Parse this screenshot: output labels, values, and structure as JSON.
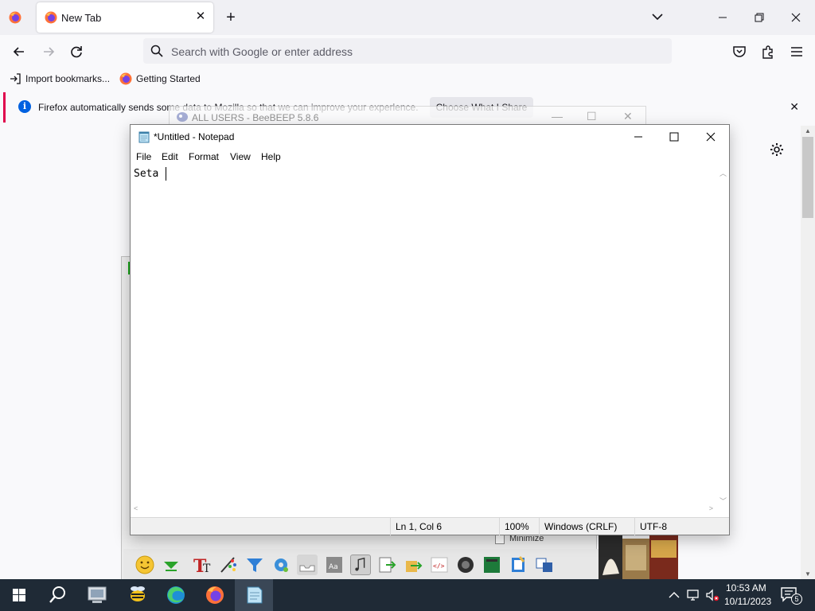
{
  "browser": {
    "tab": {
      "title": "New Tab"
    },
    "address_bar": {
      "placeholder": "Search with Google or enter address"
    },
    "bookmarks": [
      {
        "label": "Import bookmarks..."
      },
      {
        "label": "Getting Started"
      }
    ],
    "notification": {
      "text": "Firefox automatically sends some data to Mozilla so that we can improve your experience.",
      "button": "Choose What I Share"
    }
  },
  "background_windows": {
    "beebeep_title": "ALL USERS - BeeBEEP 5.8.6",
    "minimize_label": "Minimize"
  },
  "notepad": {
    "title": "*Untitled - Notepad",
    "menu": [
      "File",
      "Edit",
      "Format",
      "View",
      "Help"
    ],
    "content": "Seta ",
    "status": {
      "position": "Ln 1, Col 6",
      "zoom": "100%",
      "line_endings": "Windows (CRLF)",
      "encoding": "UTF-8"
    }
  },
  "taskbar": {
    "time": "10:53 AM",
    "date": "10/11/2023",
    "notification_count": "5"
  },
  "colors": {
    "firefox_accent": "#0061e0",
    "notice_stripe": "#e0004c",
    "taskbar_bg": "#1f2a36"
  }
}
